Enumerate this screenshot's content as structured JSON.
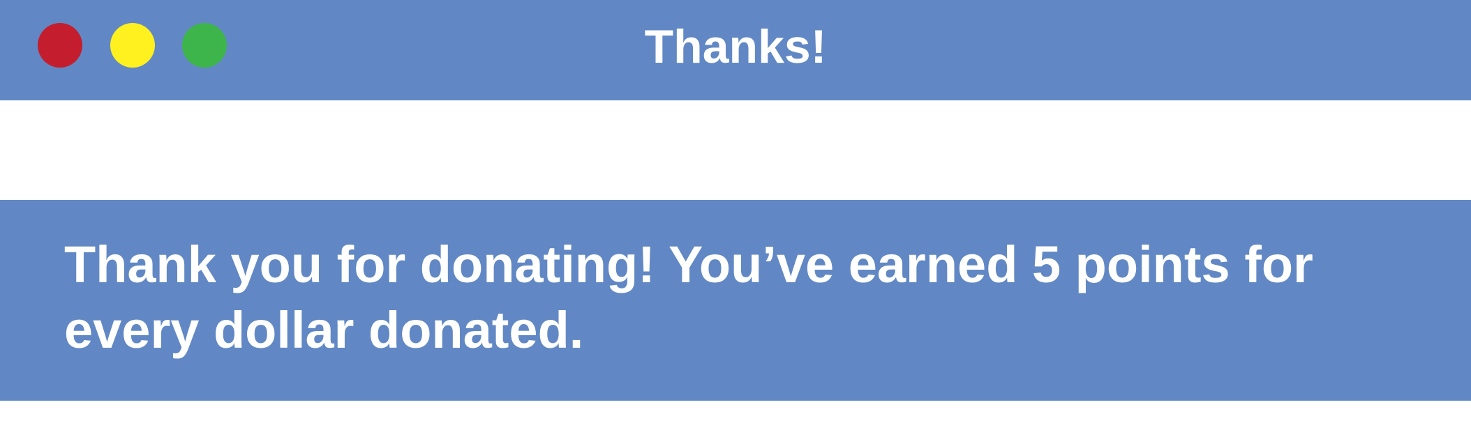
{
  "window": {
    "title": "Thanks!",
    "controls": {
      "close_color": "#c41e2e",
      "minimize_color": "#fff01f",
      "zoom_color": "#3db54a"
    },
    "accent_color": "#6188c4"
  },
  "message": {
    "text": "Thank you for donating! You’ve earned 5 points for every dollar donated."
  }
}
